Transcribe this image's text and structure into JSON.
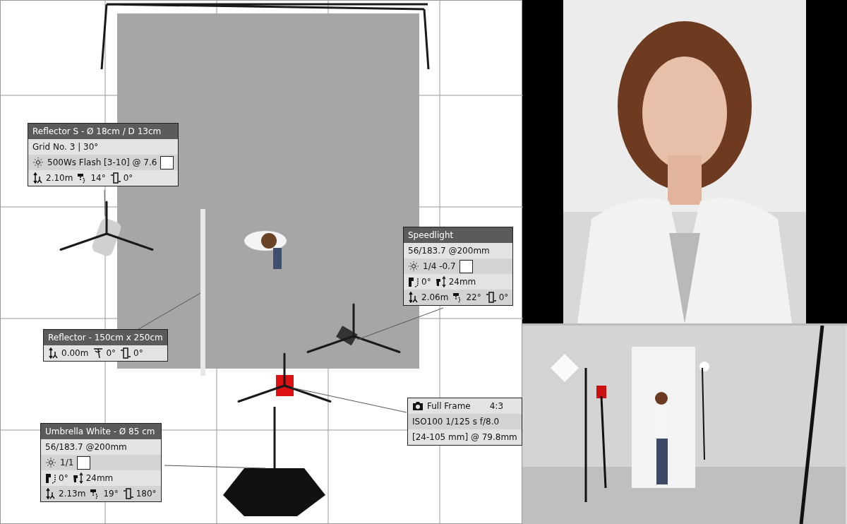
{
  "cards": [
    {
      "title": "Reflector S - Ø 18cm / D 13cm",
      "rows": [
        {
          "kind": "text",
          "text": "Grid No. 3 | 30°"
        },
        {
          "kind": "light",
          "text": "500Ws Flash [3-10] @ 7.6",
          "color": "#ffffff"
        },
        {
          "kind": "values",
          "values": [
            {
              "kind": "height",
              "text": "2.10m"
            },
            {
              "kind": "tilt",
              "text": "14°"
            },
            {
              "kind": "rotation",
              "text": "0°"
            }
          ]
        }
      ]
    },
    {
      "title": "Speedlight",
      "rows": [
        {
          "kind": "text",
          "text": "56/183.7 @200mm"
        },
        {
          "kind": "light",
          "text": "1/4 -0.7",
          "color": "#ffffff"
        },
        {
          "kind": "values",
          "values": [
            {
              "kind": "headtilt",
              "text": "0°"
            },
            {
              "kind": "zoom",
              "text": "24mm"
            }
          ]
        },
        {
          "kind": "values",
          "values": [
            {
              "kind": "height",
              "text": "2.06m"
            },
            {
              "kind": "tilt",
              "text": "22°"
            },
            {
              "kind": "rotation",
              "text": "0°"
            }
          ]
        }
      ]
    },
    {
      "title": "Reflector - 150cm x 250cm",
      "rows": [
        {
          "kind": "values",
          "values": [
            {
              "kind": "height",
              "text": "0.00m"
            },
            {
              "kind": "bend",
              "text": "0°"
            },
            {
              "kind": "rotation",
              "text": "0°"
            }
          ]
        }
      ]
    },
    {
      "title": "Umbrella White - Ø 85 cm",
      "rows": [
        {
          "kind": "text",
          "text": "56/183.7 @200mm"
        },
        {
          "kind": "light",
          "text": "1/1",
          "color": "#ffffff"
        },
        {
          "kind": "values",
          "values": [
            {
              "kind": "headtilt",
              "text": "0°"
            },
            {
              "kind": "zoom",
              "text": "24mm"
            }
          ]
        },
        {
          "kind": "values",
          "values": [
            {
              "kind": "height",
              "text": "2.13m"
            },
            {
              "kind": "tilt",
              "text": "19°"
            },
            {
              "kind": "rotation",
              "text": "180°"
            }
          ]
        }
      ]
    },
    {
      "rows": [
        {
          "kind": "camera",
          "text": "Full Frame",
          "aspect": "4:3"
        },
        {
          "kind": "text",
          "text": "ISO100  1/125 s  f/8.0"
        },
        {
          "kind": "text",
          "text": "[24-105 mm] @ 79.8mm"
        }
      ]
    }
  ]
}
